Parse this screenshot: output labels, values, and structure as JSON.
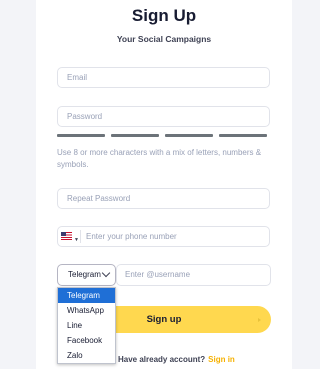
{
  "title": "Sign Up",
  "subtitle": "Your Social Campaigns",
  "email": {
    "placeholder": "Email"
  },
  "password": {
    "placeholder": "Password",
    "strength_segments_filled": 4,
    "strength_segments_total": 4
  },
  "password_hint": "Use 8 or more characters with a mix of letters, numbers & symbols.",
  "repeat_password": {
    "placeholder": "Repeat Password"
  },
  "phone": {
    "country_flag": "us-flag-icon",
    "placeholder": "Enter your phone number"
  },
  "messenger": {
    "selected": "Telegram",
    "options": [
      "Telegram",
      "WhatsApp",
      "Line",
      "Facebook",
      "Zalo"
    ],
    "username_placeholder": "Enter @username"
  },
  "submit_label": "Sign up",
  "footer": {
    "text": "Have already account?",
    "link": "Sign in"
  },
  "colors": {
    "accent": "#ffd84f",
    "link": "#f6b100",
    "dropdown_highlight": "#1f6fd6"
  }
}
